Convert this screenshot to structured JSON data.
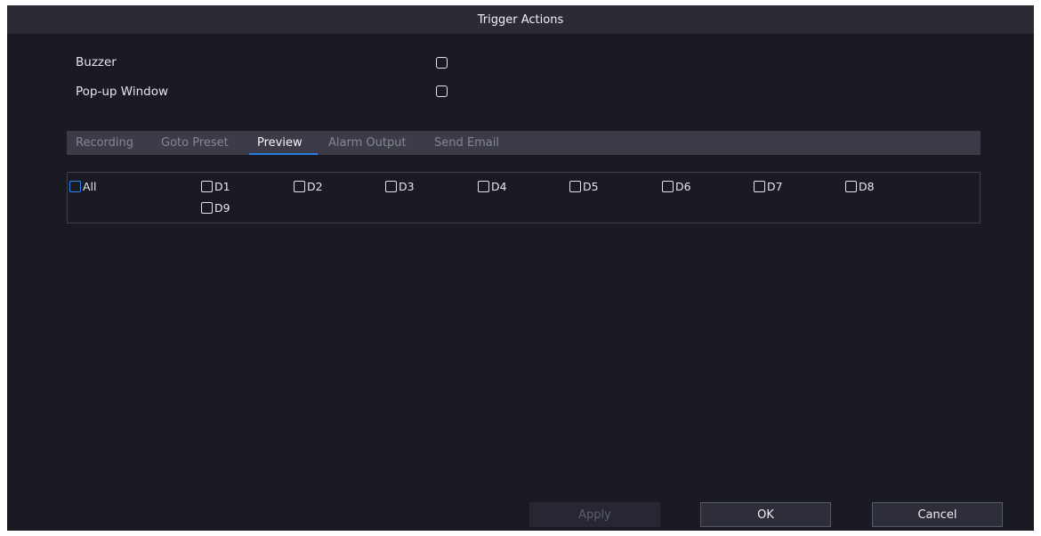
{
  "dialog": {
    "title": "Trigger Actions"
  },
  "options": [
    {
      "label": "Buzzer",
      "checked": false
    },
    {
      "label": "Pop-up Window",
      "checked": false
    }
  ],
  "tabs": [
    {
      "label": "Recording",
      "active": false
    },
    {
      "label": "Goto Preset",
      "active": false
    },
    {
      "label": "Preview",
      "active": true
    },
    {
      "label": "Alarm Output",
      "active": false
    },
    {
      "label": "Send Email",
      "active": false
    }
  ],
  "channels": [
    {
      "label": "All",
      "checked": false,
      "focused": true
    },
    {
      "label": "D1",
      "checked": false
    },
    {
      "label": "D2",
      "checked": false
    },
    {
      "label": "D3",
      "checked": false
    },
    {
      "label": "D4",
      "checked": false
    },
    {
      "label": "D5",
      "checked": false
    },
    {
      "label": "D6",
      "checked": false
    },
    {
      "label": "D7",
      "checked": false
    },
    {
      "label": "D8",
      "checked": false
    },
    {
      "label": "D9",
      "checked": false
    }
  ],
  "buttons": {
    "apply": "Apply",
    "ok": "OK",
    "cancel": "Cancel"
  },
  "colors": {
    "background": "#191a22",
    "titlebar": "#2a2b35",
    "tabbar": "#3b3c47",
    "accent": "#2a7de1"
  }
}
